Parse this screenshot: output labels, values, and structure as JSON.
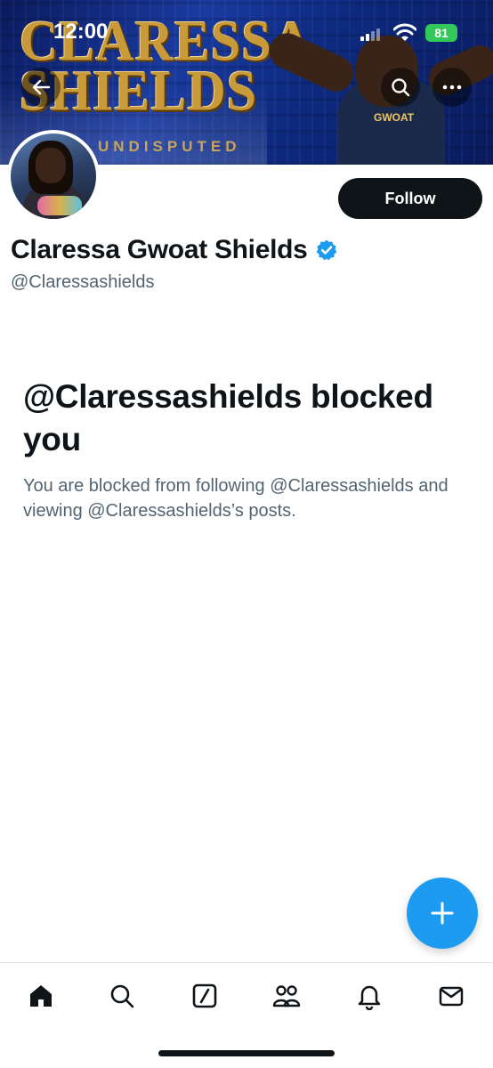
{
  "status_bar": {
    "time": "12:00",
    "battery": "81"
  },
  "banner": {
    "title_line1": "CLARESSA",
    "title_line2": "SHIELDS",
    "subtitle": "UNDISPUTED",
    "chain_text": "GWOAT"
  },
  "profile": {
    "display_name": "Claressa Gwoat Shields",
    "handle": "@Claressashields",
    "follow_label": "Follow",
    "verified_color": "#1d9bf0"
  },
  "blocked": {
    "title": "@Claressashields blocked you",
    "description": "You are blocked from following @Claressashields and viewing @Claressashields’s posts."
  },
  "nav": {
    "items": [
      "home-icon",
      "search-icon",
      "grok-icon",
      "communities-icon",
      "notifications-icon",
      "messages-icon"
    ]
  },
  "colors": {
    "accent": "#1d9bf0",
    "text_primary": "#0f1419",
    "text_secondary": "#536471"
  }
}
